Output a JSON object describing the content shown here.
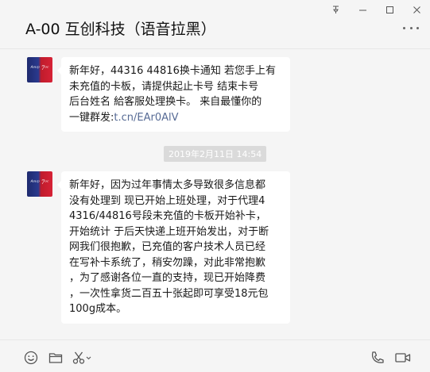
{
  "window": {
    "pin_icon": "pin-icon",
    "minimize_icon": "minimize-icon",
    "maximize_icon": "maximize-icon",
    "close_icon": "close-icon"
  },
  "header": {
    "title": "A-00 互创科技（语音拉黑）",
    "more_icon": "more-icon"
  },
  "messages": [
    {
      "avatar_text": "ᴬˢᵘᵖ 7ᵒᶜ",
      "text": "新年好，44316 44816换卡通知 若您手上有\n未充值的卡板，请提供起止卡号 结束卡号\n后台姓名 給客服处理换卡。 来自最懂你的\n一键群发:",
      "link": "t.cn/EAr0AlV"
    },
    {
      "avatar_text": "ᴬˢᵘᵖ 7ᵒᶜ",
      "text": "新年好，因为过年事情太多导致很多信息都\n没有处理到 现已开始上班处理，对于代理4\n4316/44816号段未充值的卡板开始补卡，\n开始统计 于后天快递上班开始发出，对于断\n网我们很抱歉，已充值的客户技术人员已经\n在写补卡系统了，稍安勿躁，对此非常抱歉\n，为了感谢各位一直的支持，现已开始降费\n，一次性拿货二百五十张起即可享受18元包\n100g成本。"
    }
  ],
  "timestamp": "2019年2月11日 14:54",
  "toolbar": {
    "icons": [
      "emoji-icon",
      "folder-icon",
      "scissors-icon",
      "phone-icon",
      "video-call-icon"
    ]
  }
}
